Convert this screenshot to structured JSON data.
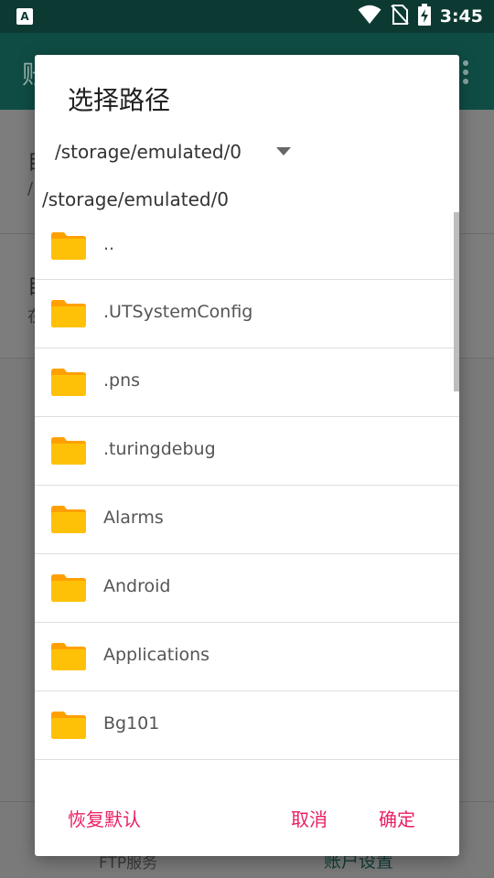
{
  "status_bar": {
    "time": "3:45",
    "app_indicator": "A",
    "icons": [
      "wifi-icon",
      "no-sim-icon",
      "battery-charging-icon"
    ]
  },
  "background_app": {
    "title": "账",
    "rows": [
      {
        "line1": "目",
        "line2": "/"
      },
      {
        "line1": "目",
        "line2": "在"
      }
    ],
    "bottom_tabs": [
      "FTP服务",
      "账户设置"
    ]
  },
  "dialog": {
    "title": "选择路径",
    "path_select_value": "/storage/emulated/0",
    "current_path": "/storage/emulated/0",
    "items": [
      {
        "name": ".."
      },
      {
        "name": ".UTSystemConfig"
      },
      {
        "name": ".pns"
      },
      {
        "name": ".turingdebug"
      },
      {
        "name": "Alarms"
      },
      {
        "name": "Android"
      },
      {
        "name": "Applications"
      },
      {
        "name": "Bg101"
      }
    ],
    "buttons": {
      "restore": "恢复默认",
      "cancel": "取消",
      "ok": "确定"
    }
  },
  "colors": {
    "accent": "#e91e63",
    "folder": "#ffc107",
    "status_bar": "#0c3a33",
    "toolbar": "#0f4d44"
  }
}
